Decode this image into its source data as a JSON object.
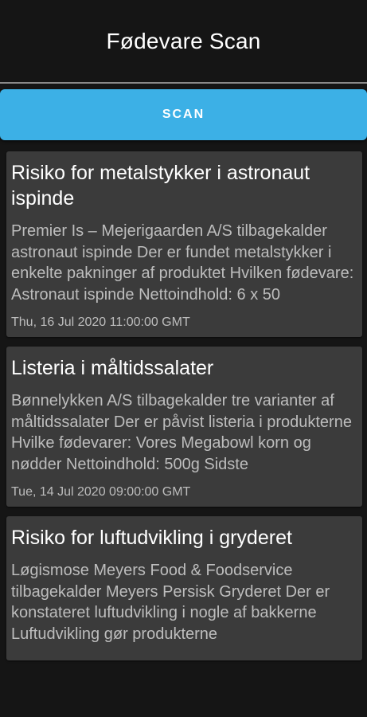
{
  "appbar": {
    "title": "Fødevare Scan"
  },
  "scan_button": {
    "label": "SCAN"
  },
  "colors": {
    "background": "#151515",
    "card": "#3b3b3b",
    "accent": "#3cb0e6",
    "text_primary": "#ffffff",
    "text_secondary": "#bdbdbd"
  },
  "recalls": [
    {
      "title": "Risiko for metalstykker i astronaut ispinde",
      "description": "Premier Is – Mejerigaarden A/S tilbagekalder astronaut ispinde Der er fundet metalstykker i enkelte pakninger af produktet Hvilken fødevare: Astronaut ispinde Nettoindhold: 6 x 50",
      "date": "Thu, 16 Jul 2020 11:00:00 GMT"
    },
    {
      "title": "Listeria i måltidssalater",
      "description": "Bønnelykken A/S tilbagekalder tre varianter af måltidssalater Der er påvist listeria i produkterne Hvilke fødevarer: Vores Megabowl korn og nødder Nettoindhold: 500g Sidste",
      "date": "Tue, 14 Jul 2020 09:00:00 GMT"
    },
    {
      "title": "Risiko for luftudvikling i gryderet",
      "description": "Løgismose Meyers Food & Foodservice tilbagekalder Meyers Persisk Gryderet Der er konstateret luftudvikling i nogle af bakkerne Luftudvikling gør produkterne",
      "date": ""
    }
  ]
}
